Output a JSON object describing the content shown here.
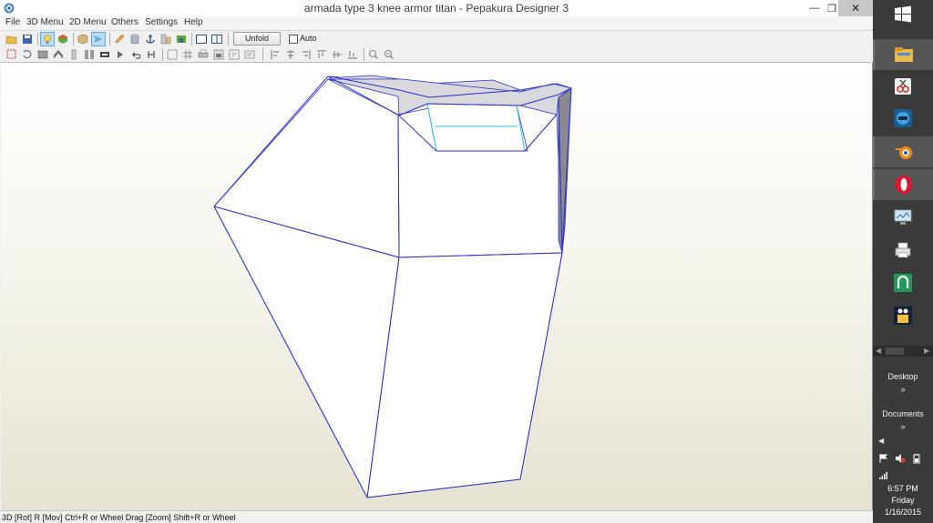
{
  "window": {
    "title": "armada type 3 knee armor titan - Pepakura Designer 3",
    "controls": {
      "minimize": "—",
      "maximize": "❐",
      "close": "✕"
    }
  },
  "menu": [
    {
      "label": "File"
    },
    {
      "label": "3D Menu"
    },
    {
      "label": "2D Menu"
    },
    {
      "label": "Others"
    },
    {
      "label": "Settings"
    },
    {
      "label": "Help"
    }
  ],
  "toolbar": {
    "unfold_label": "Unfold",
    "auto_label": "Auto",
    "auto_checked": false,
    "row1_icons": [
      "open-icon",
      "save-icon",
      "light-icon",
      "color-cube-icon",
      "box-icon",
      "paper-plane-icon",
      "pencil-icon",
      "cylinder-icon",
      "anchor-icon",
      "parts-icon",
      "tree-icon",
      "single-view-icon",
      "split-view-icon"
    ],
    "row2_icons": [
      "select-icon",
      "rotate-icon",
      "texture-icon",
      "join-icon",
      "edge-icon",
      "fold-icon",
      "flap-icon",
      "move-icon",
      "undo-flap-icon",
      "flip-icon",
      "align-icon",
      "grid-icon",
      "print-icon",
      "scale-icon",
      "text-icon",
      "align-left-icon",
      "align-center-icon",
      "align-right-icon",
      "align-top-icon",
      "align-middle-icon",
      "align-bottom-icon",
      "zoom-fit-icon",
      "zoom-page-icon"
    ]
  },
  "viewport": {
    "edge_color": "#2b2fcf",
    "accent_edge_color": "#29c7e8",
    "shade_color": "#d9d9db",
    "dark_shade_color": "#8a8a8e"
  },
  "status": {
    "text": "3D [Rot] R [Mov] Ctrl+R or Wheel Drag [Zoom] Shift+R or Wheel"
  },
  "taskbar": {
    "apps": [
      {
        "name": "file-explorer",
        "active": true
      },
      {
        "name": "snipping-tool",
        "active": false
      },
      {
        "name": "teamviewer",
        "active": false
      },
      {
        "name": "blender",
        "active": true
      },
      {
        "name": "opera",
        "active": true
      },
      {
        "name": "remote-desktop",
        "active": false
      },
      {
        "name": "printer",
        "active": false
      },
      {
        "name": "green-app",
        "active": false
      },
      {
        "name": "pepakura",
        "active": false
      }
    ],
    "desktop_label": "Desktop",
    "documents_label": "Documents",
    "chevron": "»",
    "tray_arrow": "◀"
  },
  "clock": {
    "time": "6:57 PM",
    "day": "Friday",
    "date": "1/16/2015"
  }
}
